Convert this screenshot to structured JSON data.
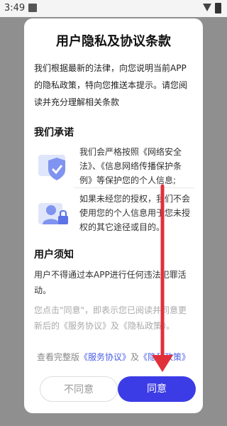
{
  "status_bar": {
    "time": "3:49"
  },
  "dialog": {
    "title": "用户隐私及协议条款",
    "intro_lines": [
      "我们根据最新的法律，向您说明当前APP",
      "的隐私政策，特向您推送本提示。请您阅",
      "读并充分理解相关条款"
    ],
    "promise_heading": "我们承诺",
    "promises": [
      {
        "lines": [
          "我们会严格按照《网络安全",
          "法》、《信息网络传播保护条",
          "例》等保护您的个人信息;"
        ],
        "icon": "shield-icon"
      },
      {
        "lines": [
          "如果未经您的授权，我们不会",
          "使用您的个人信息用于您未授",
          "权的其它途径或目的。"
        ],
        "icon": "user-lock-icon"
      }
    ],
    "notice_heading": "用户须知",
    "notice_lines": [
      "用户不得通过本APP进行任何违法犯罪活",
      "动。"
    ],
    "consent_lines": [
      "您点击\"同意\"，即表示您已阅读并同意更",
      "新后的《服务协议》及《隐私政策》。"
    ],
    "links": {
      "prefix": "查看完整版",
      "service": "《服务协议》",
      "and": "及",
      "privacy": "《隐私政策》"
    },
    "buttons": {
      "decline": "不同意",
      "agree": "同意"
    }
  },
  "colors": {
    "accent": "#3c3ce6",
    "link": "#4a5ee8",
    "arrow": "#e0303a"
  }
}
